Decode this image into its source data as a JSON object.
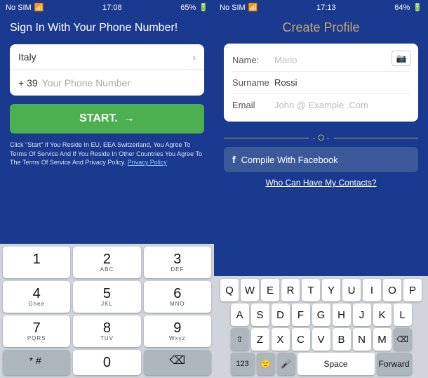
{
  "left": {
    "statusBar": {
      "carrier": "No SIM",
      "time": "17:08",
      "battery": "65%"
    },
    "title": "Sign In With Your Phone Number!",
    "countryInput": "Italy",
    "phonePrefix": "+ 39",
    "phonePlaceholder": "Your Phone Number",
    "startButton": "START.",
    "termsText": "Click \"Start\" If You Reside In EU, EEA Switzerland, You Agree To Terms Of Service And If You Reside In Other Countries You Agree To The Terms Of Service And Privacy Policy.",
    "termsLink": "Privacy Policy",
    "keypad": {
      "rows": [
        [
          {
            "main": "1",
            "sub": ""
          },
          {
            "main": "2",
            "sub": "ABC"
          },
          {
            "main": "3",
            "sub": "DEF"
          }
        ],
        [
          {
            "main": "4",
            "sub": "Ghee"
          },
          {
            "main": "5",
            "sub": "JKL"
          },
          {
            "main": "6",
            "sub": "MNO"
          }
        ],
        [
          {
            "main": "7",
            "sub": "PQRS"
          },
          {
            "main": "8",
            "sub": "TUV"
          },
          {
            "main": "9",
            "sub": "Wxyz"
          }
        ],
        [
          {
            "main": "* # ‌",
            "sub": ""
          },
          {
            "main": "0",
            "sub": ""
          },
          {
            "main": "⌫",
            "sub": ""
          }
        ]
      ]
    }
  },
  "right": {
    "statusBar": {
      "carrier": "No SIM",
      "time": "17:13",
      "battery": "64%"
    },
    "title": "Create Profile",
    "nameLabel": "Name:",
    "namePlaceholder": "Mario",
    "surnameLabel": "Surname",
    "surnameValue": "Rossi",
    "emailLabel": "Email",
    "emailPlaceholder": "John @ Example .Com",
    "dividerText": "- O -",
    "facebookButton": "Compile With Facebook",
    "contactsText": "Who Can Have My Contacts?",
    "keyboard": {
      "row1": [
        "Q",
        "W",
        "E",
        "R",
        "T",
        "Y",
        "U",
        "I",
        "O",
        "P"
      ],
      "row2": [
        "A",
        "S",
        "D",
        "F",
        "G",
        "H",
        "J",
        "K",
        "L"
      ],
      "row3": [
        "Z",
        "X",
        "C",
        "V",
        "B",
        "N",
        "M"
      ],
      "bottomLeft": "123",
      "emoji": "🙂",
      "mic": "🎤",
      "space": "Space",
      "forward": "Forward"
    }
  }
}
